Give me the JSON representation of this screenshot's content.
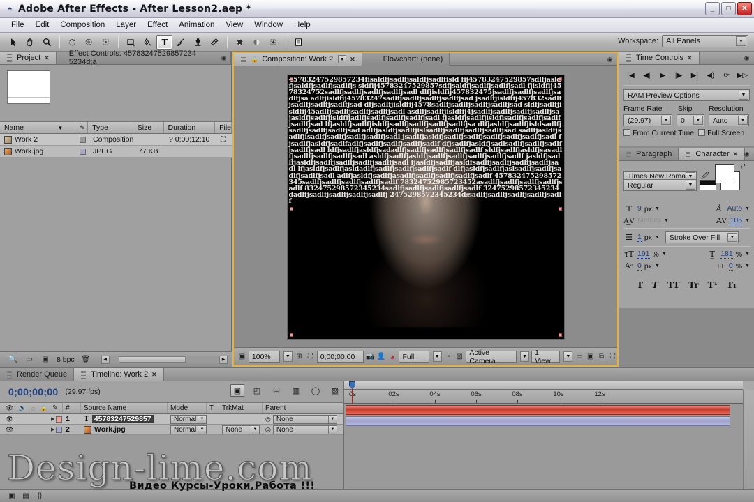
{
  "window": {
    "title": "Adobe After Effects - After Lesson2.aep *",
    "app_icon": "ae-logo-icon",
    "controls": {
      "minimize": "_",
      "maximize": "□",
      "close": "✕"
    }
  },
  "menubar": {
    "items": [
      "File",
      "Edit",
      "Composition",
      "Layer",
      "Effect",
      "Animation",
      "View",
      "Window",
      "Help"
    ]
  },
  "toolbar": {
    "tools": [
      {
        "name": "selection-tool",
        "glyph": "➤",
        "active": false
      },
      {
        "name": "hand-tool",
        "glyph": "✋",
        "active": false
      },
      {
        "name": "zoom-tool",
        "glyph": "🔍",
        "active": false
      },
      {
        "name": "rotation-tool",
        "glyph": "↻",
        "active": false
      },
      {
        "name": "orbit-camera-tool",
        "glyph": "◐",
        "active": false
      },
      {
        "name": "pan-behind-tool",
        "glyph": "⁜",
        "active": false
      },
      {
        "name": "shape-tool",
        "glyph": "▭",
        "active": false
      },
      {
        "name": "pen-tool",
        "glyph": "✒",
        "active": false
      },
      {
        "name": "text-tool",
        "glyph": "T",
        "active": true
      },
      {
        "name": "brush-tool",
        "glyph": "🖌",
        "active": false
      },
      {
        "name": "clone-stamp-tool",
        "glyph": "♟",
        "active": false
      },
      {
        "name": "eraser-tool",
        "glyph": "◢",
        "active": false
      },
      {
        "name": "puppet-pin-tool",
        "glyph": "✥",
        "active": false
      },
      {
        "name": "puppet-overlap-tool",
        "glyph": "◑",
        "active": false
      },
      {
        "name": "puppet-starch-tool",
        "glyph": "◈",
        "active": false
      },
      {
        "name": "workspace-panel-toggle",
        "glyph": "▤",
        "active": false
      }
    ],
    "workspace_label": "Workspace:",
    "workspace_value": "All Panels"
  },
  "project_panel": {
    "tabs": [
      {
        "label": "Project",
        "closable": true,
        "active": true
      },
      {
        "label": "Effect Controls: 45783247529857234 5234d;a",
        "closable": false,
        "active": false
      }
    ],
    "columns": [
      "Name",
      "Type",
      "Size",
      "Duration",
      "File"
    ],
    "rows": [
      {
        "name": "Work 2",
        "type": "Composition",
        "size": "",
        "duration": "? 0;00;12;10",
        "icon": "composition-icon"
      },
      {
        "name": "Work.jpg",
        "type": "JPEG",
        "size": "77 KB",
        "duration": "",
        "icon": "image-icon"
      }
    ],
    "bottom": {
      "bit_depth": "8 bpc"
    }
  },
  "composition_panel": {
    "tabs": [
      {
        "label": "Composition: Work 2",
        "active": true,
        "closable": true
      },
      {
        "label": "Flowchart: (none)",
        "active": false,
        "closable": false
      }
    ],
    "ascii_art": "45783247529857234fisaldfjsadlfjsaldfjsadlfisld fij45783247529857sdlfjasldfjsaldfjsadlfjsadlfjs sldfij45783247529857sdfjsaldfjsadlfjsadlfjsadl fjisldfij4578324752sadlfjsadlfjsadlfjsadlfjsadl dlfjisldfij457832475jsadlfjsadlfjsadlfjsadlfjsa adlfjisldfij45783247sadlfjsadlfjsadlfjsadlfjsad jsadlfjisldfij457832sadlfjsadlfjsadlfjsadlfjsad dfjsadlfjisldfij4578sadlfjsadlfjsadlfjsadlfjsad sldfjsadlfjisldfij45adlfjsadlfjsadlfjsadlfjsadl asdlfjsadlfjisldfij4jsadlfjsadlfjsadlfjsadlfjsa jasldfjsadlfjisldfijadlfjsadlfjsadlfjsadlfjsadl fjasldfjsadlfjisldfisadlfjsadlfjsadlfjsadlfjsad lfjasldfjsadlfjisldfjsadlfjsadlfjsadlfjsadlfjsa dlfjasldfjsadlfjisldsadlfjsadlfjsadlfjsadlfjsad adlfjasldfjsadlfjislsadlfjsadlfjsadlfjsadlfjsad sadlfjasldfjsadlfjisadlfjsadlfjsadlfjsadlfjsadl jsadlfjasldfjsadlfjsadlfjsadlfjsadlfjsadlfjsadl fjsadlfjasldfjsadlfadlfjsadlfjsadlfjsadlfjsadlf dfjsadlfjasldfjsadlsadlfjsadlfjsadlfjsadlfjsadl ldfjsadlfjasldfjsadadlfjsadlfjsadlfjsadlfjsadlf sldfjsadlfjasldfjsasadlfjsadlfjsadlfjsadlfjsadl asldfjsadlfjasldfjsadlfjsadlfjsadlfjsadlfjsadlf jasldfjsadlfjasldfjsadlfjsadlfjsadlfjsadlfjsadl fjasldfjsadlfjasldfsadlfjsadlfjsadlfjsadlfjsadl lfjasldfjsadlfjasldadlfjsadlfjsadlfjsadlfjsadlf dlfjasldfjsadlfjaslsadlfjsadlfjsadlfjsadlfjsadl adlfjasldfjsadlfjasadlfjsadlfjsadlfjsadlfjsadlf 457832475298572345sadlfjsadlfjsadlfjsadlfjsadlf 78324752985723452asadlfjsadlfjsadlfjsadlfjsadlf 832475298572345234sadlfjsadlfjsadlfjsadlfjsadlf 32475298572345234dadlfjsadlfjsadlfjsadlfjsadlfj 2475298572345234d;sadlfjsadlfjsadlfjsadlfjsadlf",
    "toolbar": {
      "zoom": "100%",
      "timecode": "0;00;00;00",
      "resolution": "Full",
      "camera": "Active Camera",
      "views": "1 View"
    }
  },
  "time_controls": {
    "tab_label": "Time Controls",
    "transport": [
      {
        "name": "first-frame-button",
        "glyph": "|◀"
      },
      {
        "name": "previous-frame-button",
        "glyph": "◀|"
      },
      {
        "name": "play-button",
        "glyph": "▶"
      },
      {
        "name": "next-frame-button",
        "glyph": "|▶"
      },
      {
        "name": "last-frame-button",
        "glyph": "▶|"
      },
      {
        "name": "audio-toggle-button",
        "glyph": "◀)"
      },
      {
        "name": "loop-button",
        "glyph": "⟳"
      },
      {
        "name": "ram-preview-button",
        "glyph": "▶▷"
      }
    ],
    "preview_options": "RAM Preview Options",
    "frame_rate_label": "Frame Rate",
    "frame_rate_value": "(29.97)",
    "skip_label": "Skip",
    "skip_value": "0",
    "resolution_label": "Resolution",
    "resolution_value": "Auto",
    "from_current_time_label": "From Current Time",
    "full_screen_label": "Full Screen"
  },
  "character_panel": {
    "tabs": [
      {
        "label": "Paragraph",
        "active": false
      },
      {
        "label": "Character",
        "active": true,
        "closable": true
      }
    ],
    "font_family": "Times New Roman",
    "font_style": "Regular",
    "font_size": "9",
    "font_size_unit": "px",
    "leading": "Auto",
    "kerning": "Metrics",
    "tracking": "105",
    "stroke_width": "1",
    "stroke_width_unit": "px",
    "stroke_order": "Stroke Over Fill",
    "vertical_scale": "191",
    "horizontal_scale": "181",
    "baseline_shift": "0",
    "baseline_unit": "px",
    "tsume": "0",
    "tsume_unit": "%",
    "style_buttons": [
      "T",
      "T",
      "TT",
      "Tr",
      "T¹",
      "T₁"
    ]
  },
  "timeline_panel": {
    "tabs": [
      {
        "label": "Render Queue",
        "active": false
      },
      {
        "label": "Timeline: Work 2",
        "active": true,
        "closable": true
      }
    ],
    "current_time": "0;00;00;00",
    "fps": "(29.97 fps)",
    "columns": [
      "#",
      "Source Name",
      "Mode",
      "T",
      "TrkMat",
      "Parent"
    ],
    "layers": [
      {
        "index": "1",
        "source_name": "45783247529857",
        "type_icon": "text-layer-icon",
        "mode": "Normal",
        "trkmat": "",
        "parent": "None",
        "color": "#f0a095",
        "bar": "bar-red",
        "selected": true
      },
      {
        "index": "2",
        "source_name": "Work.jpg",
        "type_icon": "image-layer-icon",
        "mode": "Normal",
        "trkmat": "None",
        "parent": "None",
        "color": "#a8aad4",
        "bar": "bar-blue",
        "selected": false
      }
    ],
    "ruler_ticks": [
      "0s",
      "02s",
      "04s",
      "06s",
      "08s",
      "10s",
      "12s"
    ]
  },
  "watermark": {
    "main": "Design-lime.com",
    "sub": "Видео Курсы-Уроки,Работа !!!"
  },
  "colors": {
    "accent_orange": "#e8b23a",
    "panel_gray": "#9b9b9b",
    "number_blue": "#1c3f86",
    "layer_red": "#c43828",
    "layer_blue": "#9ea2cd"
  }
}
